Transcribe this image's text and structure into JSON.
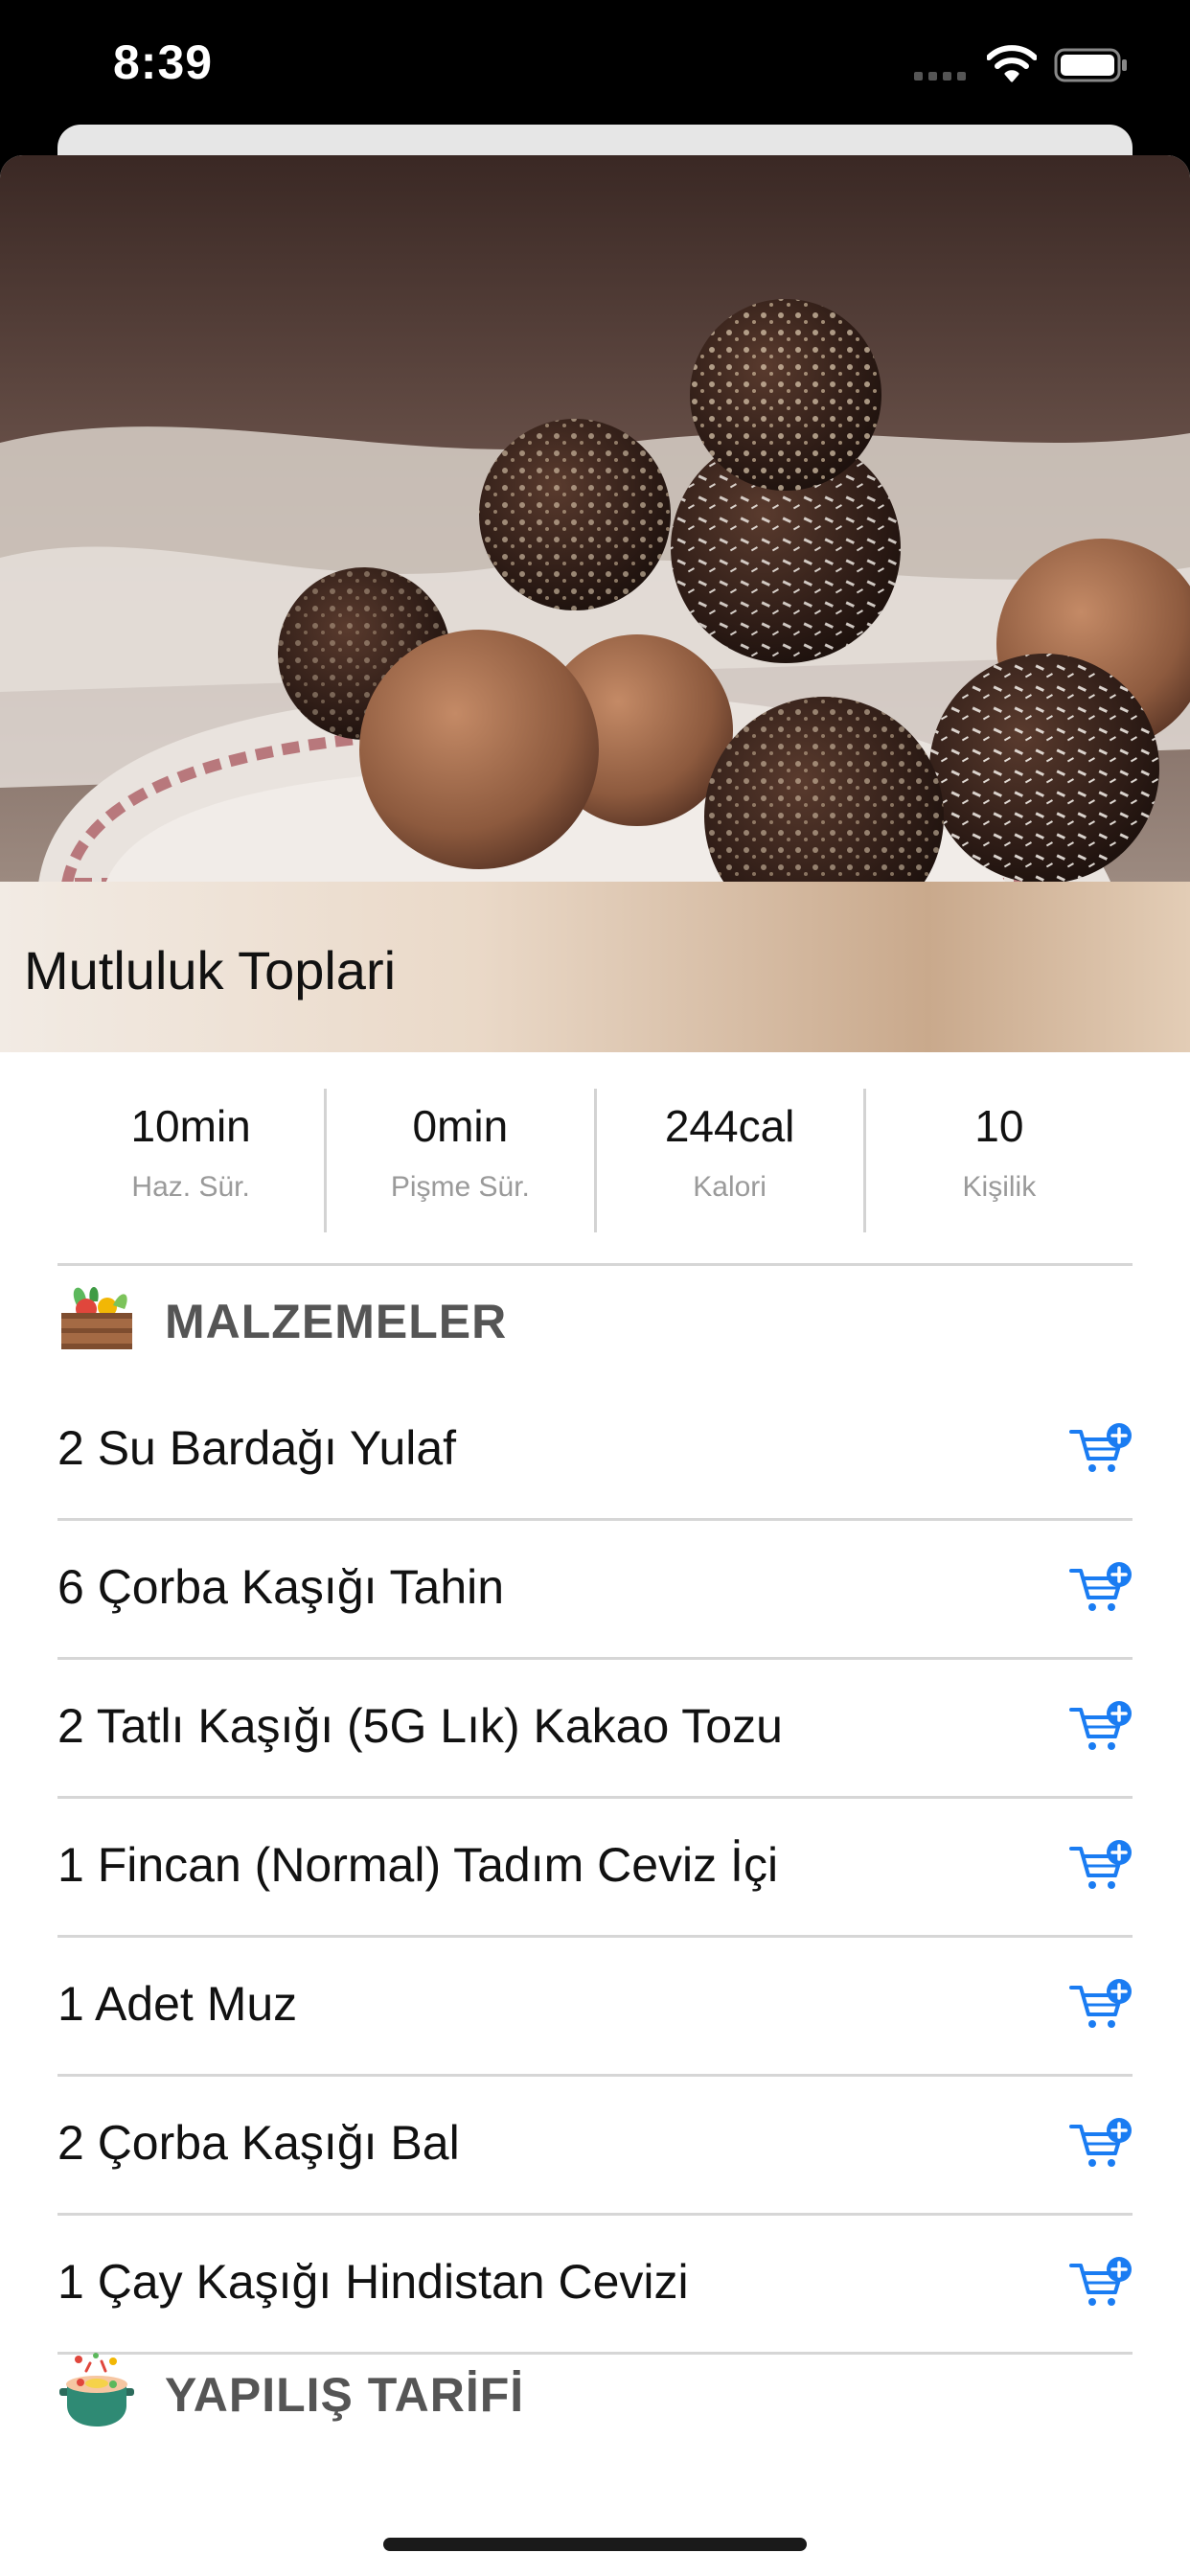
{
  "status_bar": {
    "time": "8:39"
  },
  "recipe": {
    "title": "Mutluluk Toplari"
  },
  "stats": [
    {
      "value": "10min",
      "label": "Haz. Sür."
    },
    {
      "value": "0min",
      "label": "Pişme Sür."
    },
    {
      "value": "244cal",
      "label": "Kalori"
    },
    {
      "value": "10",
      "label": "Kişilik"
    }
  ],
  "ingredients_section": {
    "title": "MALZEMELER",
    "icon": "vegetable-crate-icon"
  },
  "ingredients": [
    {
      "name": "2 Su Bardağı Yulaf"
    },
    {
      "name": "6 Çorba Kaşığı Tahin"
    },
    {
      "name": "2 Tatlı Kaşığı (5G Lık) Kakao Tozu"
    },
    {
      "name": "1 Fincan (Normal) Tadım Ceviz İçi"
    },
    {
      "name": "1 Adet Muz"
    },
    {
      "name": "2 Çorba Kaşığı Bal"
    },
    {
      "name": "1 Çay Kaşığı Hindistan Cevizi"
    }
  ],
  "instructions_section": {
    "title": "YAPILIŞ TARİFİ",
    "icon": "cooking-pot-icon"
  },
  "colors": {
    "accent": "#1a7cf2",
    "section_title": "#555555",
    "divider": "#d6d6d6"
  }
}
